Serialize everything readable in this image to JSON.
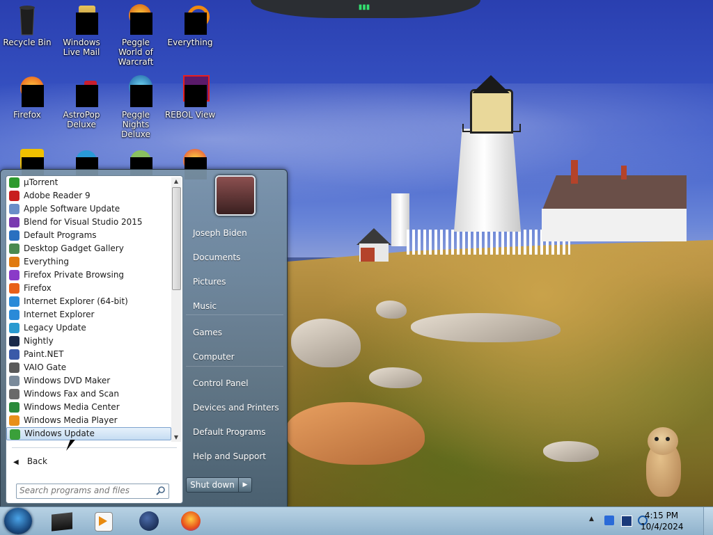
{
  "desktop": {
    "icons": [
      {
        "label": "Recycle Bin"
      },
      {
        "label": "Windows Live Mail"
      },
      {
        "label": "Peggle World of Warcraft"
      },
      {
        "label": "Everything"
      },
      {
        "label": "Firefox"
      },
      {
        "label": "AstroPop Deluxe"
      },
      {
        "label": "Peggle Nights Deluxe"
      },
      {
        "label": "REBOL View"
      }
    ]
  },
  "start_menu": {
    "programs": [
      {
        "label": "µTorrent",
        "icon": "utorrent-icon",
        "color": "#2e9a2e"
      },
      {
        "label": "Adobe Reader 9",
        "icon": "adobe-reader-icon",
        "color": "#c81e1e"
      },
      {
        "label": "Apple Software Update",
        "icon": "apple-update-icon",
        "color": "#6a8ec8"
      },
      {
        "label": "Blend for Visual Studio 2015",
        "icon": "blend-icon",
        "color": "#7a3ab0"
      },
      {
        "label": "Default Programs",
        "icon": "default-programs-icon",
        "color": "#2a70c0"
      },
      {
        "label": "Desktop Gadget Gallery",
        "icon": "gadget-gallery-icon",
        "color": "#4a8a50"
      },
      {
        "label": "Everything",
        "icon": "everything-search-icon",
        "color": "#e07a10"
      },
      {
        "label": "Firefox Private Browsing",
        "icon": "firefox-private-icon",
        "color": "#8a3ac8"
      },
      {
        "label": "Firefox",
        "icon": "firefox-icon",
        "color": "#e8601a"
      },
      {
        "label": "Internet Explorer (64-bit)",
        "icon": "ie64-icon",
        "color": "#2a8ad8"
      },
      {
        "label": "Internet Explorer",
        "icon": "ie-icon",
        "color": "#2a8ad8"
      },
      {
        "label": "Legacy Update",
        "icon": "legacy-update-icon",
        "color": "#2a9ad0"
      },
      {
        "label": "Nightly",
        "icon": "nightly-icon",
        "color": "#1a2a4a"
      },
      {
        "label": "Paint.NET",
        "icon": "paintnet-icon",
        "color": "#3a5aa8"
      },
      {
        "label": "VAIO Gate",
        "icon": "vaio-gate-icon",
        "color": "#5a5a5a"
      },
      {
        "label": "Windows DVD Maker",
        "icon": "dvd-maker-icon",
        "color": "#7a8a9a"
      },
      {
        "label": "Windows Fax and Scan",
        "icon": "fax-scan-icon",
        "color": "#6a6a6a"
      },
      {
        "label": "Windows Media Center",
        "icon": "media-center-icon",
        "color": "#2a8a3a"
      },
      {
        "label": "Windows Media Player",
        "icon": "media-player-icon",
        "color": "#e8901a"
      },
      {
        "label": "Windows Update",
        "icon": "windows-update-icon",
        "color": "#3aa03a"
      }
    ],
    "back_label": "Back",
    "search_placeholder": "Search programs and files",
    "right_links": [
      {
        "label": "Joseph Biden",
        "name": "user-name-link"
      },
      {
        "label": "Documents",
        "name": "documents-link"
      },
      {
        "label": "Pictures",
        "name": "pictures-link"
      },
      {
        "label": "Music",
        "name": "music-link"
      },
      {
        "label": "Games",
        "name": "games-link"
      },
      {
        "label": "Computer",
        "name": "computer-link"
      },
      {
        "label": "Control Panel",
        "name": "control-panel-link"
      },
      {
        "label": "Devices and Printers",
        "name": "devices-printers-link"
      },
      {
        "label": "Default Programs",
        "name": "default-programs-link"
      },
      {
        "label": "Help and Support",
        "name": "help-support-link"
      }
    ],
    "shutdown_label": "Shut down"
  },
  "taskbar": {
    "clock_time": "4:15 PM",
    "clock_date": "10/4/2024"
  }
}
